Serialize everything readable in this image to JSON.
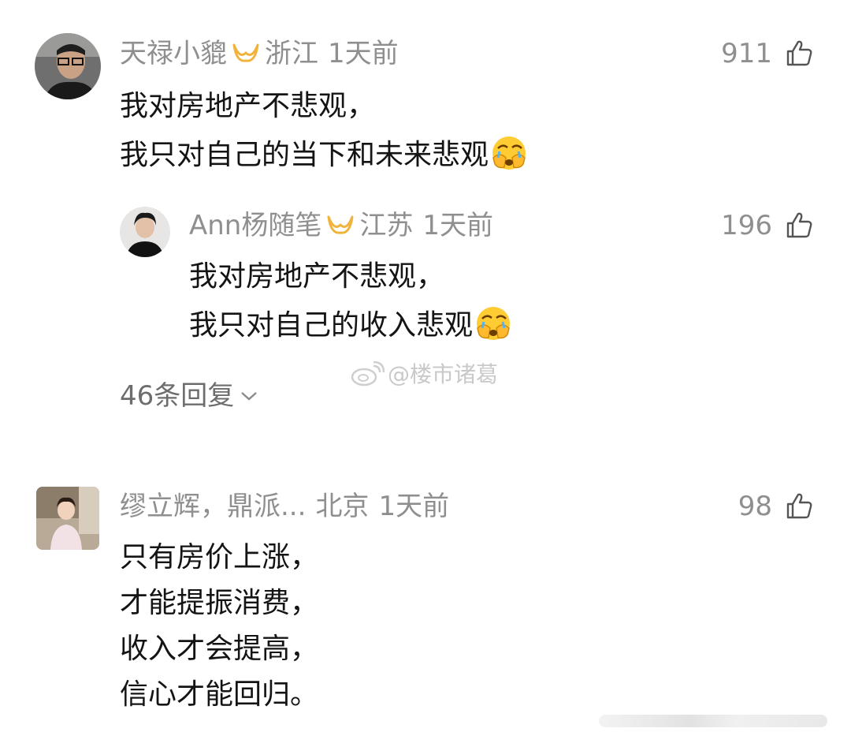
{
  "colors": {
    "meta_gray": "#8f8f8f",
    "text": "#141414",
    "vip_gold": "#f0b43c"
  },
  "comments": [
    {
      "username": "天禄小貔",
      "location": "浙江",
      "time": "1天前",
      "likes": "911",
      "lines": [
        "我对房地产不悲观，",
        "我只对自己的当下和未来悲观"
      ],
      "emoji": "facepalm-cry-emoji"
    },
    {
      "username": "Ann杨随笔",
      "location": "江苏",
      "time": "1天前",
      "likes": "196",
      "lines": [
        "我对房地产不悲观，",
        "我只对自己的收入悲观"
      ],
      "emoji": "facepalm-cry-emoji"
    },
    {
      "username": "缪立辉，鼎派...",
      "location": "北京",
      "time": "1天前",
      "likes": "98",
      "lines": [
        "只有房价上涨，",
        "才能提振消费，",
        "收入才会提高，",
        "信心才能回归。"
      ]
    }
  ],
  "replies_label": "46条回复",
  "watermark": "@楼市诸葛"
}
